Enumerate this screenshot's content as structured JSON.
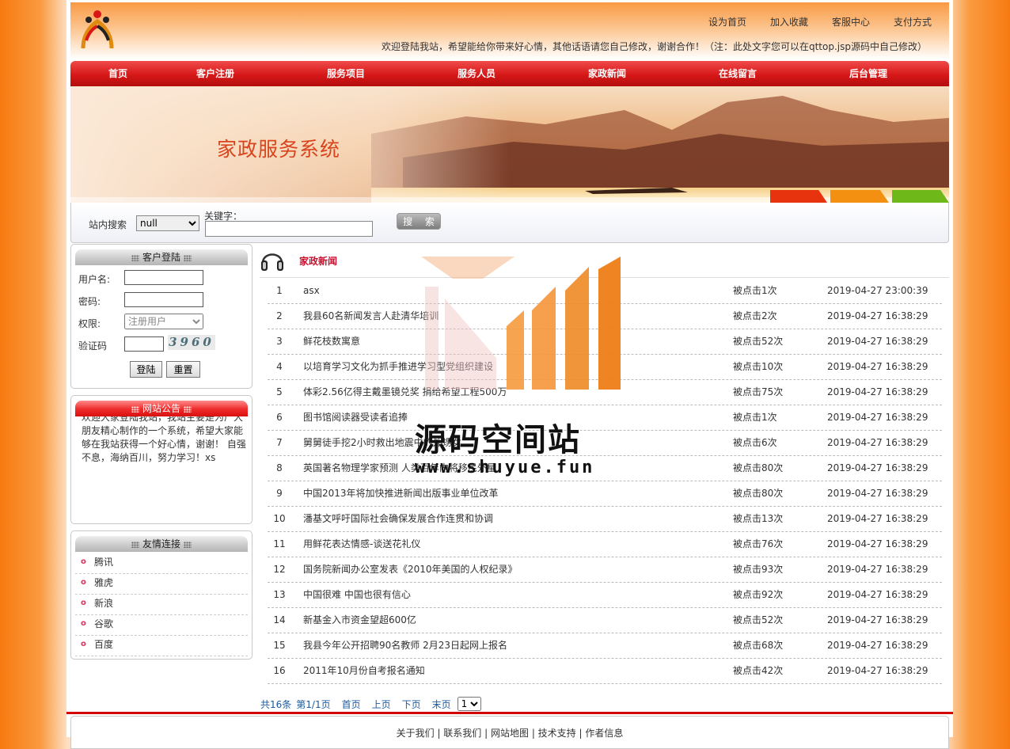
{
  "header": {
    "top_links": [
      "设为首页",
      "加入收藏",
      "客服中心",
      "支付方式"
    ],
    "welcome": "欢迎登陆我站，希望能给你带来好心情，其他话语请您自己修改，谢谢合作！（注：此处文字您可以在qttop.jsp源码中自己修改）"
  },
  "nav": [
    "首页",
    "客户注册",
    "服务项目",
    "服务人员",
    "家政新闻",
    "在线留言",
    "后台管理"
  ],
  "banner": {
    "title": "家政服务系统"
  },
  "search": {
    "label": "站内搜索",
    "select_value": "null",
    "keyword_label": "关键字：",
    "keyword_value": "",
    "button": "搜 索"
  },
  "login": {
    "title": "客户登陆",
    "username_label": "用户名:",
    "password_label": "密码:",
    "role_label": "权限:",
    "role_value": "注册用户",
    "captcha_label": "验证码",
    "captcha_image_text": "3960",
    "login_button": "登陆",
    "reset_button": "重置"
  },
  "notice": {
    "title": "网站公告",
    "text": "欢迎大家登陆我站，我站主要是为广大朋友精心制作的一个系统，希望大家能够在我站获得一个好心情，谢谢！ 自强不息，海纳百川，努力学习！xs"
  },
  "friends": {
    "title": "友情连接",
    "items": [
      "腾讯",
      "雅虎",
      "新浪",
      "谷歌",
      "百度"
    ]
  },
  "news": {
    "title": "家政新闻",
    "rows": [
      {
        "idx": "1",
        "title": "asx",
        "clicks": "被点击1次",
        "date": "2019-04-27 23:00:39"
      },
      {
        "idx": "2",
        "title": "我县60名新闻发言人赴清华培训",
        "clicks": "被点击2次",
        "date": "2019-04-27 16:38:29"
      },
      {
        "idx": "3",
        "title": "鲜花枝数寓意",
        "clicks": "被点击52次",
        "date": "2019-04-27 16:38:29"
      },
      {
        "idx": "4",
        "title": "以培育学习文化为抓手推进学习型党组织建设",
        "clicks": "被点击10次",
        "date": "2019-04-27 16:38:29"
      },
      {
        "idx": "5",
        "title": "体彩2.56亿得主戴墨镜兑奖 捐给希望工程500万",
        "clicks": "被点击75次",
        "date": "2019-04-27 16:38:29"
      },
      {
        "idx": "6",
        "title": "图书馆阅读器受读者追捧",
        "clicks": "被点击1次",
        "date": "2019-04-27 16:38:29"
      },
      {
        "idx": "7",
        "title": "舅舅徒手挖2小时救出地震中的外甥女",
        "clicks": "被点击6次",
        "date": "2019-04-27 16:38:29"
      },
      {
        "idx": "8",
        "title": "英国著名物理学家预测 人类百年内将移民外星",
        "clicks": "被点击80次",
        "date": "2019-04-27 16:38:29"
      },
      {
        "idx": "9",
        "title": "中国2013年将加快推进新闻出版事业单位改革",
        "clicks": "被点击80次",
        "date": "2019-04-27 16:38:29"
      },
      {
        "idx": "10",
        "title": "潘基文呼吁国际社会确保发展合作连贯和协调",
        "clicks": "被点击13次",
        "date": "2019-04-27 16:38:29"
      },
      {
        "idx": "11",
        "title": "用鲜花表达情感-谈送花礼仪",
        "clicks": "被点击76次",
        "date": "2019-04-27 16:38:29"
      },
      {
        "idx": "12",
        "title": "国务院新闻办公室发表《2010年美国的人权纪录》",
        "clicks": "被点击93次",
        "date": "2019-04-27 16:38:29"
      },
      {
        "idx": "13",
        "title": "中国很难 中国也很有信心",
        "clicks": "被点击92次",
        "date": "2019-04-27 16:38:29"
      },
      {
        "idx": "14",
        "title": "新基金入市资金望超600亿",
        "clicks": "被点击52次",
        "date": "2019-04-27 16:38:29"
      },
      {
        "idx": "15",
        "title": "我县今年公开招聘90名教师 2月23日起网上报名",
        "clicks": "被点击68次",
        "date": "2019-04-27 16:38:29"
      },
      {
        "idx": "16",
        "title": "2011年10月份自考报名通知",
        "clicks": "被点击42次",
        "date": "2019-04-27 16:38:29"
      }
    ]
  },
  "pager": {
    "total": "共16条",
    "page": "第1/1页",
    "first": "首页",
    "prev": "上页",
    "next": "下页",
    "last": "末页",
    "select_value": "1"
  },
  "footer": {
    "links": [
      "关于我们",
      "联系我们",
      "网站地图",
      "技术支持",
      "作者信息"
    ],
    "separator": " | "
  },
  "watermark": {
    "text": "源码空间站",
    "url": "www.shuyue.fun"
  },
  "colors": {
    "nav_red": "#d71818",
    "news_title": "#c8102e",
    "pager_blue": "#1d5a9e",
    "background_orange": "#f77a10"
  }
}
